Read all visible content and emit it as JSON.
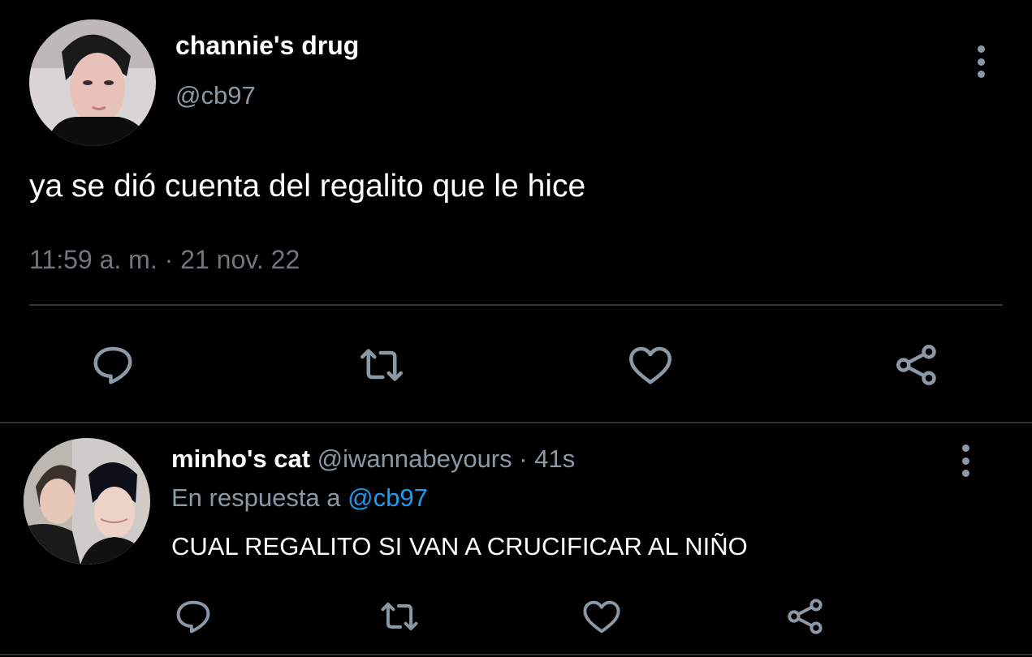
{
  "main_tweet": {
    "display_name": "channie's drug",
    "handle": "@cb97",
    "text": "ya se dió cuenta del regalito que le hice",
    "timestamp": "11:59 a. m. · 21 nov. 22",
    "actions": [
      "reply-icon",
      "retweet-icon",
      "like-icon",
      "share-icon"
    ]
  },
  "reply_tweet": {
    "display_name": "minho's cat",
    "handle": "@iwannabeyours",
    "separator": "·",
    "time_ago": "41s",
    "reply_prefix": "En respuesta a",
    "reply_mention": "@cb97",
    "text": "CUAL REGALITO SI VAN A CRUCIFICAR AL NIÑO",
    "actions": [
      "reply-icon",
      "retweet-icon",
      "like-icon",
      "share-icon"
    ]
  },
  "colors": {
    "background": "#000000",
    "primary_text": "#ffffff",
    "secondary_text": "#8b98a5",
    "divider": "#2f3336",
    "link": "#1d9bf0"
  }
}
